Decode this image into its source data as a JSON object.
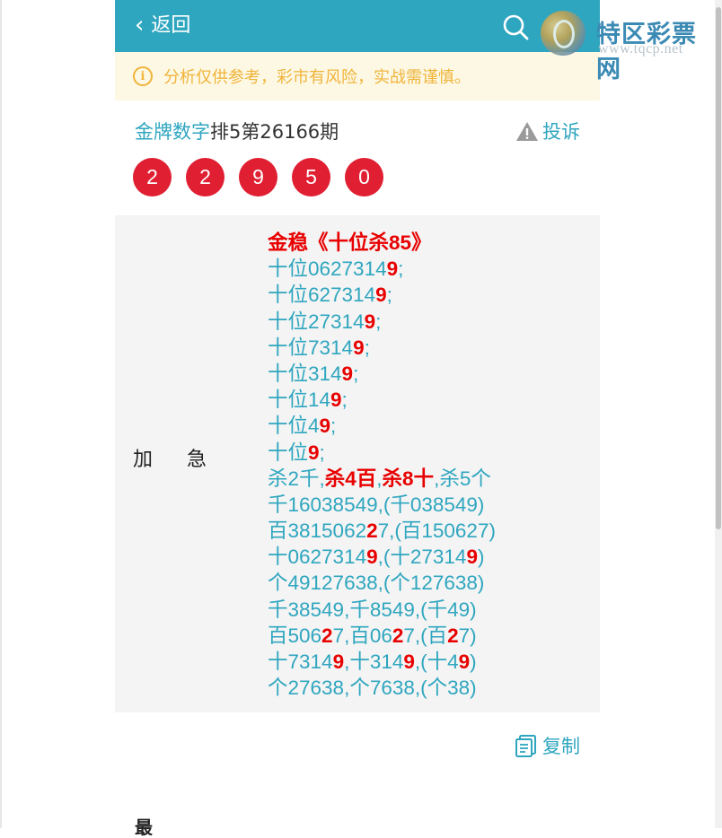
{
  "header": {
    "back_icon": "chevron-left",
    "back_label": "返回",
    "search_icon": "search"
  },
  "notice": {
    "icon": "info-circle",
    "text": "分析仅供参考，彩市有风险，实战需谨慎。"
  },
  "detail": {
    "author": "金牌数字",
    "issue": "排5第26166期",
    "report_label": "投诉",
    "report_icon": "warning-triangle"
  },
  "result_numbers": [
    "2",
    "2",
    "9",
    "5",
    "0"
  ],
  "prediction": {
    "label": "加急",
    "lines": [
      [
        {
          "t": "金稳《十位杀85》",
          "hl": true
        }
      ],
      [
        {
          "t": "十位062731"
        },
        {
          "t": "4",
          "hl": false
        },
        {
          "t": "9",
          "hl": true
        },
        {
          "t": ";"
        }
      ],
      [
        {
          "t": "十位627314"
        },
        {
          "t": "9",
          "hl": true
        },
        {
          "t": ";"
        }
      ],
      [
        {
          "t": "十位27314"
        },
        {
          "t": "9",
          "hl": true
        },
        {
          "t": ";"
        }
      ],
      [
        {
          "t": "十位7314"
        },
        {
          "t": "9",
          "hl": true
        },
        {
          "t": ";"
        }
      ],
      [
        {
          "t": "十位314"
        },
        {
          "t": "9",
          "hl": true
        },
        {
          "t": ";"
        }
      ],
      [
        {
          "t": "十位14"
        },
        {
          "t": "9",
          "hl": true
        },
        {
          "t": ";"
        }
      ],
      [
        {
          "t": "十位4"
        },
        {
          "t": "9",
          "hl": true
        },
        {
          "t": ";"
        }
      ],
      [
        {
          "t": "十位"
        },
        {
          "t": "9",
          "hl": true
        },
        {
          "t": ";"
        }
      ],
      [
        {
          "t": "杀2千,"
        },
        {
          "t": "杀4百",
          "hl": true
        },
        {
          "t": ","
        },
        {
          "t": "杀8十",
          "hl": true
        },
        {
          "t": ",杀5个"
        }
      ],
      [
        {
          "t": "千16038549,(千038549)"
        }
      ],
      [
        {
          "t": "百3815062"
        },
        {
          "t": "2",
          "hl": true
        },
        {
          "t": "7,(百150627)"
        }
      ],
      [
        {
          "t": "十0627314"
        },
        {
          "t": "9",
          "hl": true
        },
        {
          "t": ",(十27314"
        },
        {
          "t": "9",
          "hl": true
        },
        {
          "t": ")"
        }
      ],
      [
        {
          "t": "个49127638,(个127638)"
        }
      ],
      [
        {
          "t": "千38549,千8549,(千49)"
        }
      ],
      [
        {
          "t": "百506"
        },
        {
          "t": "2",
          "hl": true
        },
        {
          "t": "7,百06"
        },
        {
          "t": "2",
          "hl": true
        },
        {
          "t": "7,(百"
        },
        {
          "t": "2",
          "hl": true
        },
        {
          "t": "7)"
        }
      ],
      [
        {
          "t": "十7314"
        },
        {
          "t": "9",
          "hl": true
        },
        {
          "t": ",十314"
        },
        {
          "t": "9",
          "hl": true
        },
        {
          "t": ",(十4"
        },
        {
          "t": "9",
          "hl": true
        },
        {
          "t": ")"
        }
      ],
      [
        {
          "t": "个27638,个7638,(个38)"
        }
      ]
    ]
  },
  "copy": {
    "label": "复制",
    "icon": "copy-document"
  },
  "bottom_partial_text": "最",
  "watermark": {
    "name": "特区彩票网",
    "url": "www.tqcp.net"
  },
  "colors": {
    "primary": "#2fa6bf",
    "ball": "#e01f33",
    "highlight": "#e80000",
    "notice_text": "#f0b43b",
    "notice_bg": "#fdf8e4"
  }
}
